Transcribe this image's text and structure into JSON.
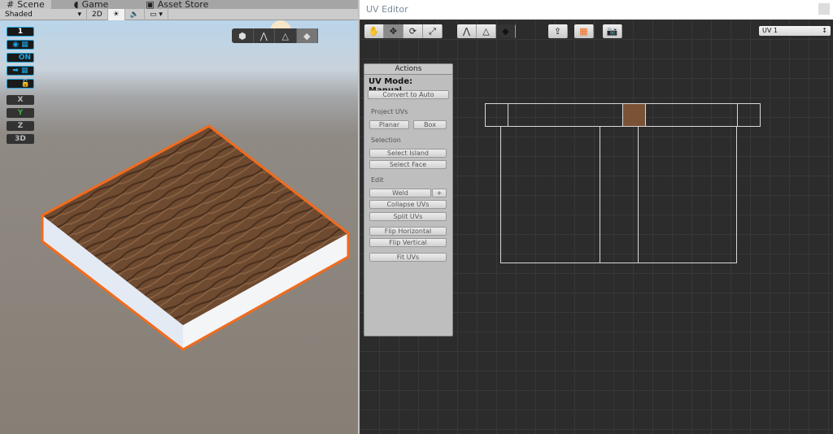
{
  "scene": {
    "tabs": [
      {
        "label": "Scene",
        "icon": "grid-icon"
      },
      {
        "label": "Game",
        "icon": "pacman-icon"
      },
      {
        "label": "Asset Store",
        "icon": "bag-icon"
      }
    ],
    "draw_mode": "Shaded",
    "mode_2d": "2D",
    "toggles": [
      "1",
      "ON",
      "X",
      "Y",
      "Z",
      "3D"
    ]
  },
  "uv_editor": {
    "title": "UV Editor",
    "channel": "UV 1",
    "actions": {
      "header": "Actions",
      "mode": "UV Mode: Manual",
      "convert": "Convert to Auto",
      "project_label": "Project UVs",
      "planar": "Planar",
      "box": "Box",
      "selection_label": "Selection",
      "select_island": "Select Island",
      "select_face": "Select Face",
      "edit_label": "Edit",
      "weld": "Weld",
      "weld_plus": "+",
      "collapse": "Collapse UVs",
      "split": "Split UVs",
      "flip_h": "Flip Horizontal",
      "flip_v": "Flip Vertical",
      "fit": "Fit UVs"
    }
  },
  "colors": {
    "accent": "#f26b1d",
    "toggle_blue": "#1fa3e0"
  }
}
